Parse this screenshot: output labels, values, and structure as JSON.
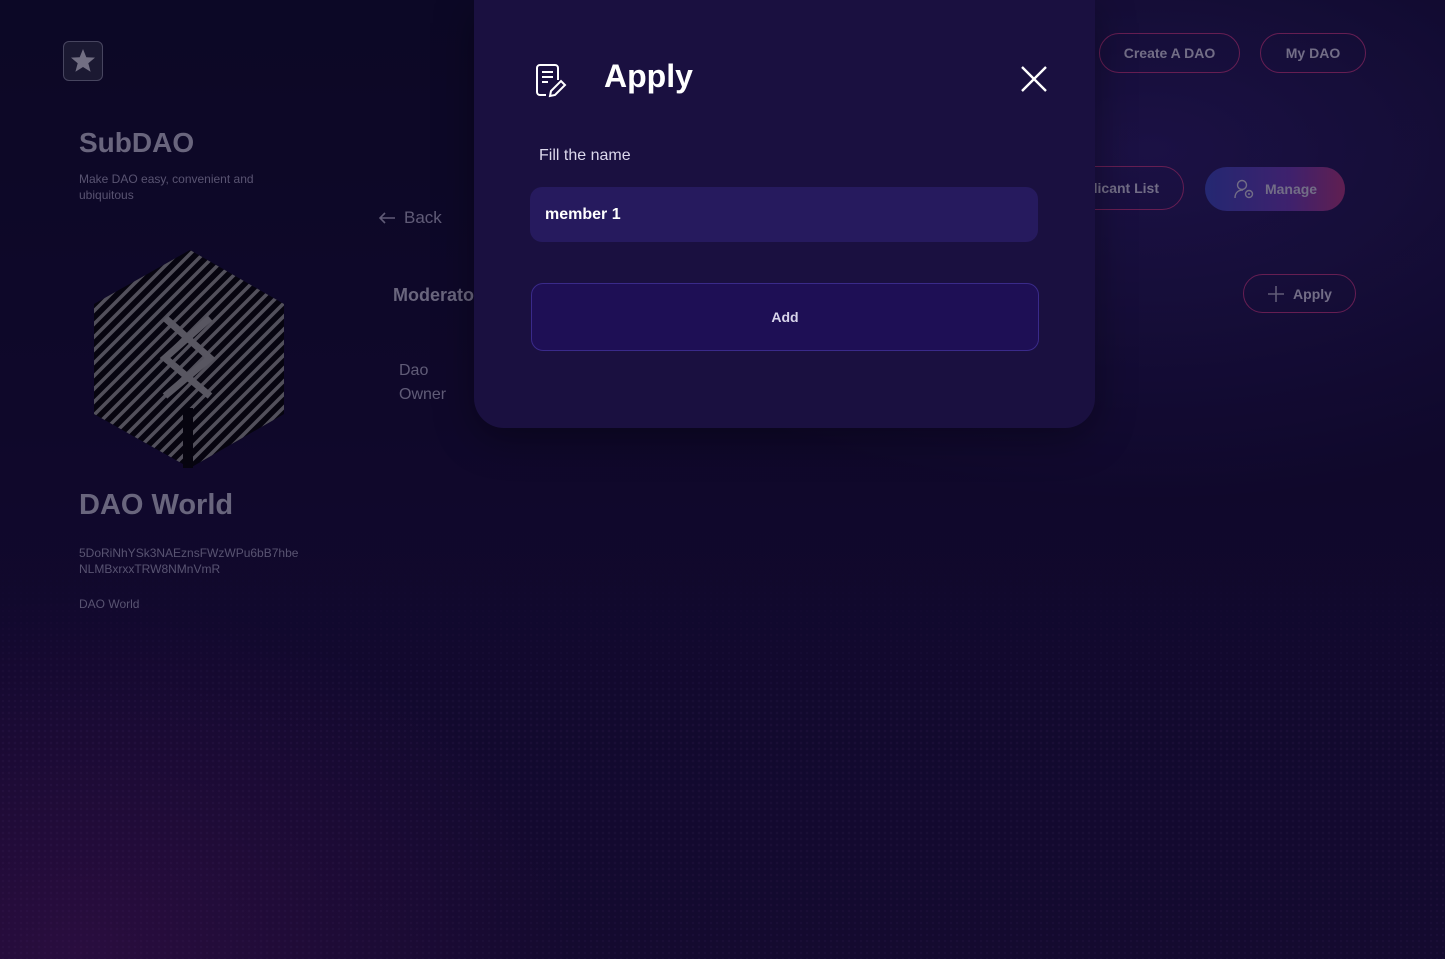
{
  "brand": {
    "name": "SubDAO",
    "tagline": "Make DAO easy, convenient and ubiquitous"
  },
  "header": {
    "create_dao_label": "Create A DAO",
    "my_dao_label": "My DAO"
  },
  "dao": {
    "name": "DAO World",
    "address": "5DoRiNhYSk3NAEznsFWzWPu6bB7hbeNLMBxrxxTRW8NMnVmR",
    "description": "DAO World"
  },
  "nav": {
    "back_label": "Back"
  },
  "moderators": {
    "title": "Moderators",
    "cell": "Dao Owner"
  },
  "actions": {
    "applicant_list_label": "Applicant List",
    "manage_label": "Manage",
    "apply_label": "Apply"
  },
  "modal": {
    "title": "Apply",
    "field_label": "Fill the name",
    "input_value": "member 1",
    "add_label": "Add"
  },
  "colors": {
    "accent_border": "#b3337f",
    "modal_bg": "#1a1040",
    "input_bg": "#261a5e"
  },
  "icons": {
    "logo": "star-icon",
    "back": "arrow-left-icon",
    "manage": "user-settings-icon",
    "apply": "plus-icon",
    "modal": "edit-document-icon",
    "close": "close-icon"
  }
}
